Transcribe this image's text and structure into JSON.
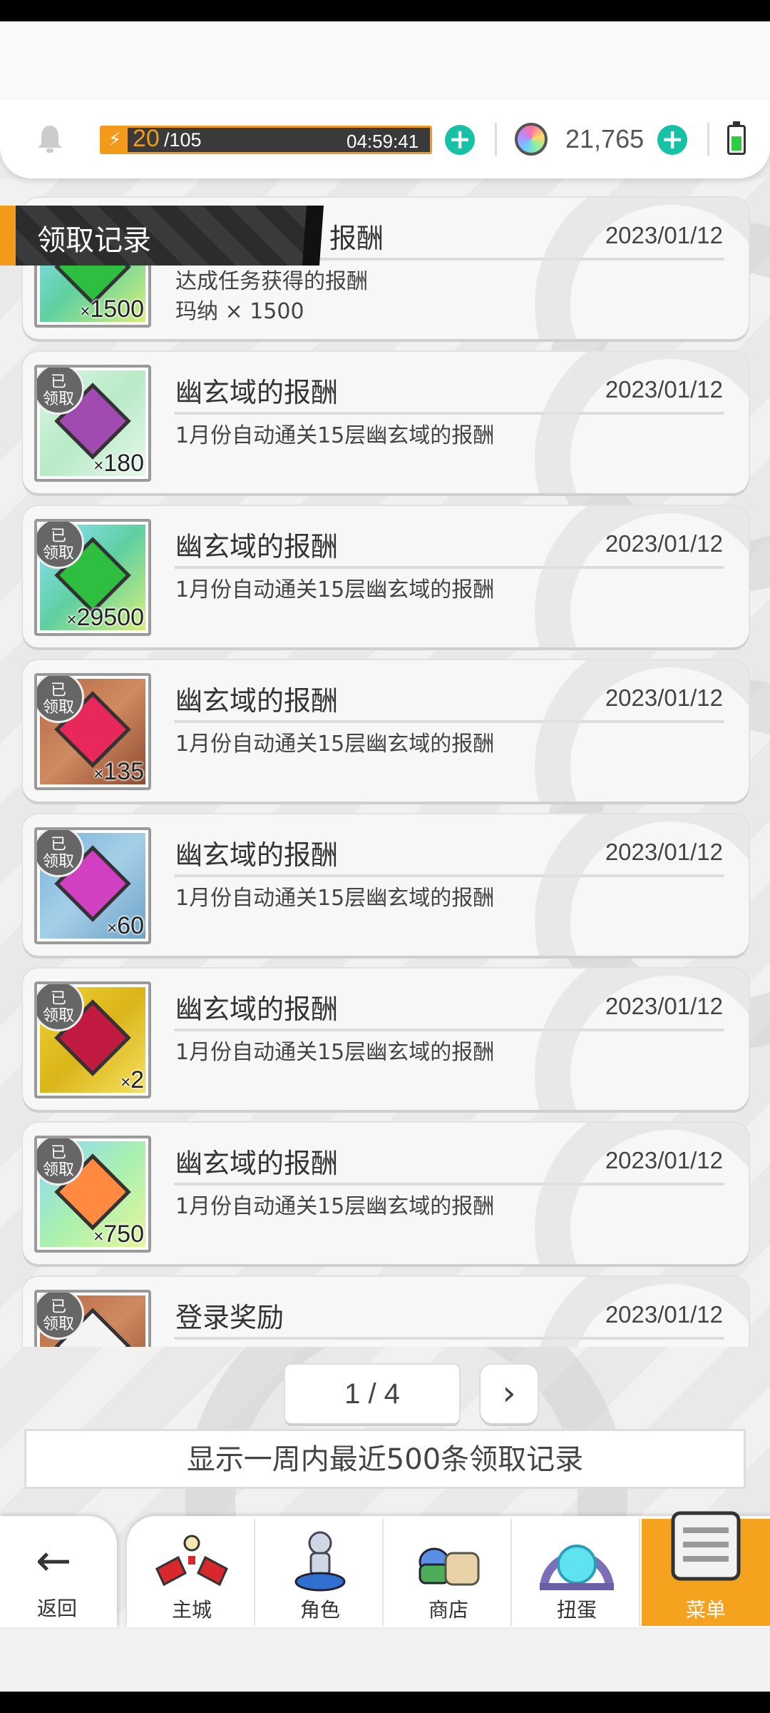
{
  "status": {
    "stamina_current": "20",
    "stamina_max": "/105",
    "timer": "04:59:41",
    "gems": "21,765"
  },
  "banner": {
    "title": "领取记录"
  },
  "records": [
    {
      "title": "报酬",
      "date": "2023/01/12",
      "desc1": "达成任务获得的报酬",
      "desc2": "玛纳 × 1500",
      "qty": "1500",
      "claimed": "",
      "thumb": "green-gem"
    },
    {
      "title": "幽玄域的报酬",
      "date": "2023/01/12",
      "desc1": "1月份自动通关15层幽玄域的报酬",
      "desc2": "",
      "qty": "180",
      "claimed": "已领取",
      "thumb": "purple-ore"
    },
    {
      "title": "幽玄域的报酬",
      "date": "2023/01/12",
      "desc1": "1月份自动通关15层幽玄域的报酬",
      "desc2": "",
      "qty": "29500",
      "claimed": "已领取",
      "thumb": "green-gem"
    },
    {
      "title": "幽玄域的报酬",
      "date": "2023/01/12",
      "desc1": "1月份自动通关15层幽玄域的报酬",
      "desc2": "",
      "qty": "135",
      "claimed": "已领取",
      "thumb": "red-gem"
    },
    {
      "title": "幽玄域的报酬",
      "date": "2023/01/12",
      "desc1": "1月份自动通关15层幽玄域的报酬",
      "desc2": "",
      "qty": "60",
      "claimed": "已领取",
      "thumb": "pink-crystal"
    },
    {
      "title": "幽玄域的报酬",
      "date": "2023/01/12",
      "desc1": "1月份自动通关15层幽玄域的报酬",
      "desc2": "",
      "qty": "2",
      "claimed": "已领取",
      "thumb": "ruby-cube"
    },
    {
      "title": "幽玄域的报酬",
      "date": "2023/01/12",
      "desc1": "1月份自动通关15层幽玄域的报酬",
      "desc2": "",
      "qty": "750",
      "claimed": "已领取",
      "thumb": "rainbow-orb"
    },
    {
      "title": "登录奖励",
      "date": "2023/01/12",
      "desc1": "",
      "desc2": "",
      "qty": "",
      "claimed": "已领取",
      "thumb": "potion"
    }
  ],
  "qty_prefix": "×",
  "pagination": {
    "page": "1 / 4",
    "next": "›"
  },
  "notice": "显示一周内最近500条领取记录",
  "nav": {
    "back": "返回",
    "items": [
      "主城",
      "角色",
      "商店",
      "扭蛋",
      "菜单"
    ]
  },
  "colors": {
    "accent": "#f5a21e",
    "plus": "#17c1a6"
  }
}
